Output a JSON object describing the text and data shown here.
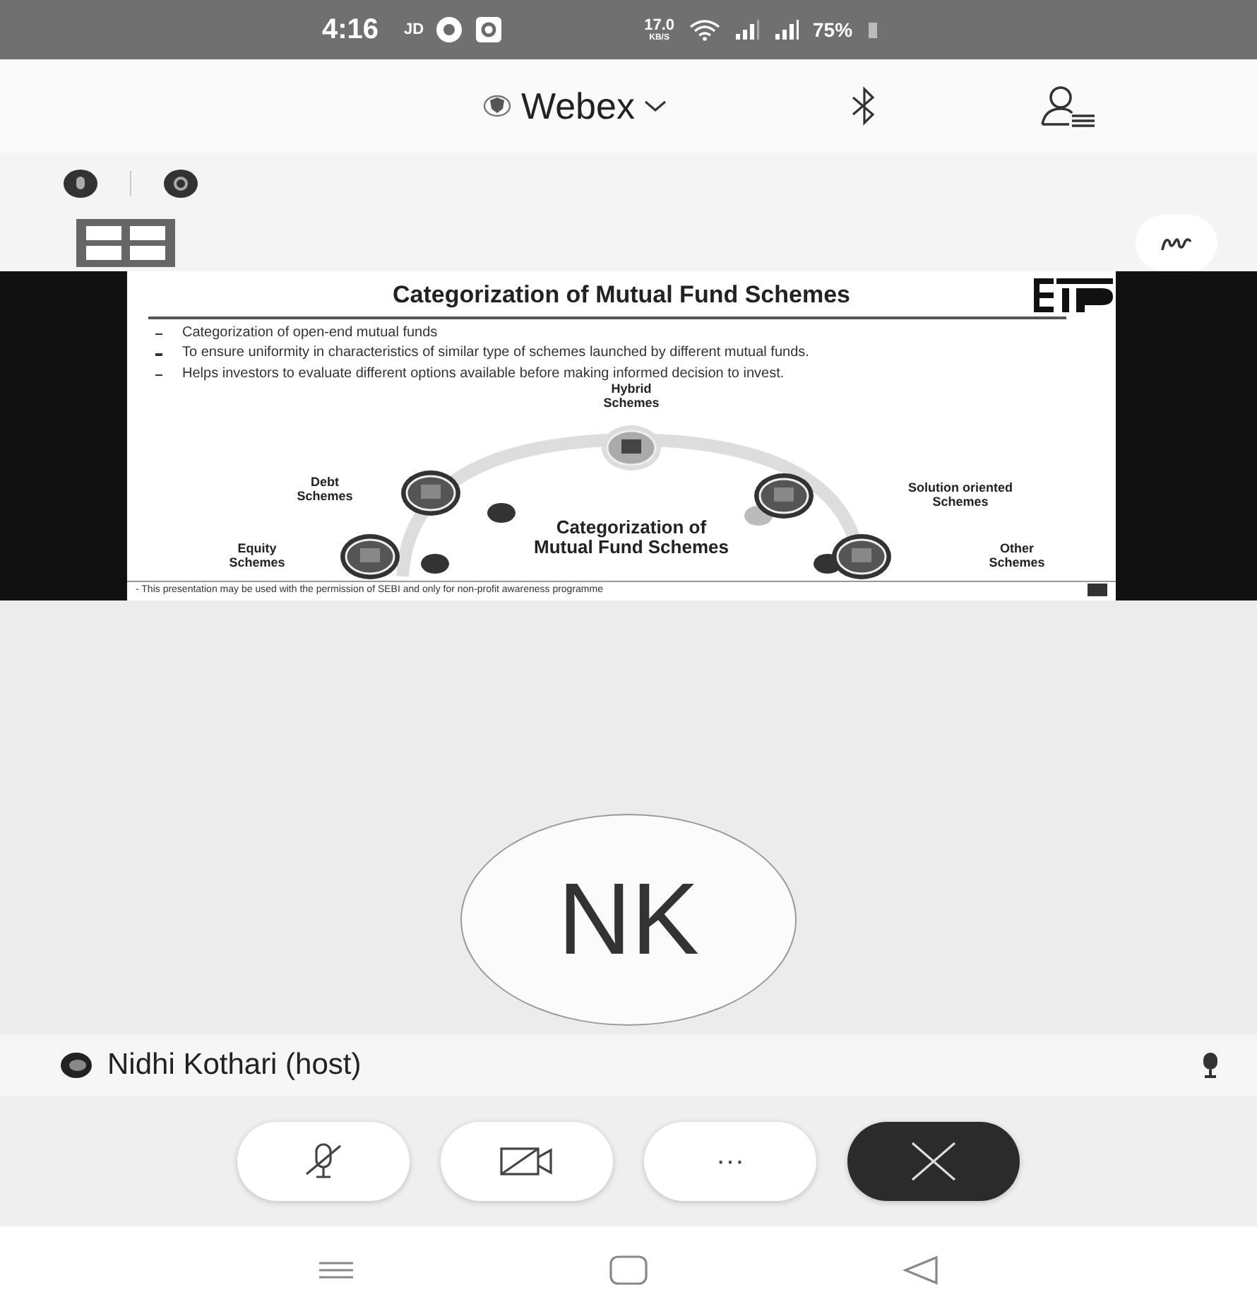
{
  "status_bar": {
    "time": "4:16",
    "carrier": "JD",
    "speed": "17.0",
    "speed_unit": "KB/S",
    "battery": "75%"
  },
  "header": {
    "title": "Webex"
  },
  "slide": {
    "title": "Categorization of Mutual Fund Schemes",
    "bullets": [
      "Categorization of open-end mutual funds",
      "To ensure uniformity in characteristics of similar type of schemes launched by different mutual funds.",
      "Helps investors to evaluate different options available before making informed decision to invest."
    ],
    "diagram": {
      "center": "Categorization of Mutual Fund Schemes",
      "nodes": [
        {
          "label": "Hybrid Schemes"
        },
        {
          "label": "Debt Schemes"
        },
        {
          "label": "Equity Schemes"
        },
        {
          "label": "Solution oriented Schemes"
        },
        {
          "label": "Other Schemes"
        }
      ]
    },
    "footer": "- This presentation may be used with the permission of SEBI and only for non-profit awareness programme"
  },
  "participant": {
    "initials": "NK",
    "name": "Nidhi Kothari (host)"
  },
  "controls": [
    {
      "kind": "mic-off"
    },
    {
      "kind": "camera-off"
    },
    {
      "kind": "more",
      "label": "···"
    },
    {
      "kind": "end"
    }
  ]
}
